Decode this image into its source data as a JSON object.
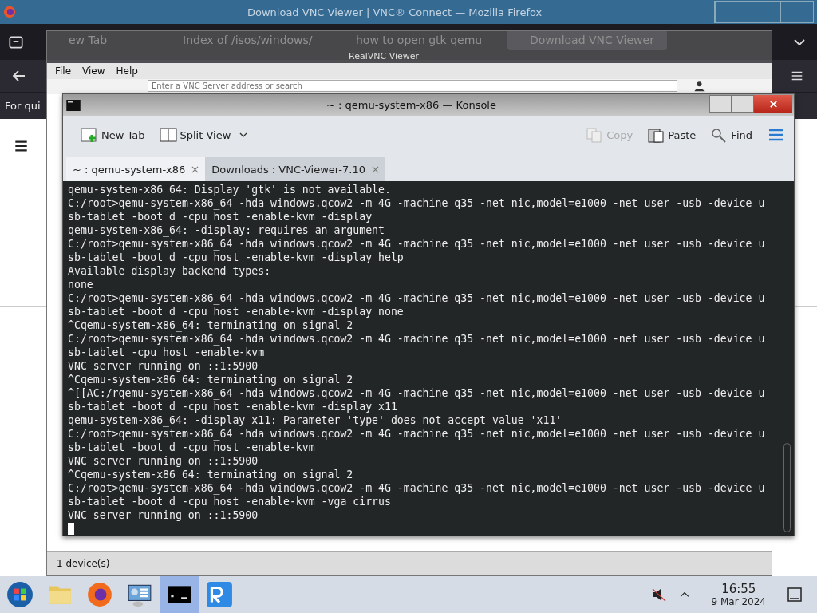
{
  "firefox": {
    "title": "Download VNC Viewer | VNC® Connect — Mozilla Firefox",
    "tabs": [
      {
        "label": "ew Tab",
        "selected": false
      },
      {
        "label": "Index of /isos/windows/",
        "selected": false
      },
      {
        "label": "how to open gtk qemu",
        "selected": false
      },
      {
        "label": "Download VNC Viewer",
        "selected": true
      }
    ],
    "bookmark_text": "For qui"
  },
  "vnc_viewer": {
    "title": "RealVNC Viewer",
    "menu": [
      "File",
      "View",
      "Help"
    ],
    "search": {
      "placeholder": "Enter a VNC Server address or search"
    },
    "status_bar": "1 device(s)"
  },
  "konsole": {
    "title": "~ : qemu-system-x86 — Konsole",
    "toolbar": [
      {
        "label": "New Tab",
        "kind": "newtab",
        "disabled": false
      },
      {
        "label": "Split View",
        "kind": "split",
        "disabled": false
      },
      {
        "label": "Copy",
        "kind": "copy",
        "disabled": true
      },
      {
        "label": "Paste",
        "kind": "paste",
        "disabled": false
      },
      {
        "label": "Find",
        "kind": "find",
        "disabled": false
      }
    ],
    "tabs": [
      {
        "label": "~ : qemu-system-x86",
        "selected": true
      },
      {
        "label": "Downloads : VNC-Viewer-7.10",
        "selected": false
      }
    ],
    "lines": [
      "qemu-system-x86_64: Display 'gtk' is not available.",
      "C:/root>qemu-system-x86_64 -hda windows.qcow2 -m 4G -machine q35 -net nic,model=e1000 -net user -usb -device u",
      "sb-tablet -boot d -cpu host -enable-kvm -display",
      "qemu-system-x86_64: -display: requires an argument",
      "C:/root>qemu-system-x86_64 -hda windows.qcow2 -m 4G -machine q35 -net nic,model=e1000 -net user -usb -device u",
      "sb-tablet -boot d -cpu host -enable-kvm -display help",
      "Available display backend types:",
      "none",
      "C:/root>qemu-system-x86_64 -hda windows.qcow2 -m 4G -machine q35 -net nic,model=e1000 -net user -usb -device u",
      "sb-tablet -boot d -cpu host -enable-kvm -display none",
      "^Cqemu-system-x86_64: terminating on signal 2",
      "C:/root>qemu-system-x86_64 -hda windows.qcow2 -m 4G -machine q35 -net nic,model=e1000 -net user -usb -device u",
      "sb-tablet -cpu host -enable-kvm",
      "VNC server running on ::1:5900",
      "^Cqemu-system-x86_64: terminating on signal 2",
      "^[[AC:/rqemu-system-x86_64 -hda windows.qcow2 -m 4G -machine q35 -net nic,model=e1000 -net user -usb -device u",
      "sb-tablet -boot d -cpu host -enable-kvm -display x11",
      "qemu-system-x86_64: -display x11: Parameter 'type' does not accept value 'x11'",
      "C:/root>qemu-system-x86_64 -hda windows.qcow2 -m 4G -machine q35 -net nic,model=e1000 -net user -usb -device u",
      "sb-tablet -boot d -cpu host -enable-kvm",
      "VNC server running on ::1:5900",
      "^Cqemu-system-x86_64: terminating on signal 2",
      "C:/root>qemu-system-x86_64 -hda windows.qcow2 -m 4G -machine q35 -net nic,model=e1000 -net user -usb -device u",
      "sb-tablet -boot d -cpu host -enable-kvm -vga cirrus",
      "VNC server running on ::1:5900"
    ]
  },
  "taskbar": {
    "apps": [
      {
        "kind": "start",
        "selected": false
      },
      {
        "kind": "files",
        "selected": false
      },
      {
        "kind": "firefox",
        "selected": false
      },
      {
        "kind": "remote",
        "selected": false
      },
      {
        "kind": "terminal",
        "selected": true
      },
      {
        "kind": "vnc",
        "selected": false
      }
    ],
    "time": "16:55",
    "date": "9 Mar 2024"
  }
}
